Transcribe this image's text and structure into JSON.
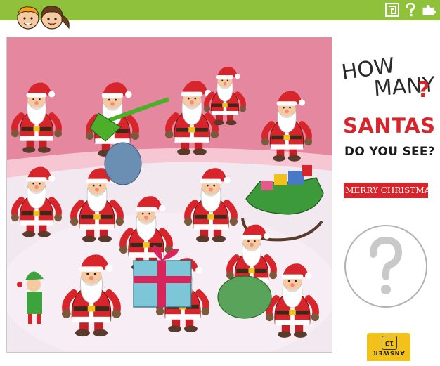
{
  "header": {
    "kids_icon": "two-kids-logo",
    "icons": [
      "maze-icon",
      "question-mark-icon",
      "puzzle-piece-icon"
    ]
  },
  "scene": {
    "description_icon": "santas-illustration"
  },
  "question": {
    "how": "HOW",
    "many": "MANY",
    "qmark": "?",
    "subject": "SANTAS",
    "prompt": "DO YOU SEE?"
  },
  "banner": {
    "star": "★",
    "text": "MERRY CHRISTMAS"
  },
  "answer_area": {
    "placeholder": "?"
  },
  "answer_tab": {
    "number": "13",
    "label": "ANSWER"
  },
  "colors": {
    "topbar": "#8fc23a",
    "accent_red": "#d8242b",
    "tab_yellow": "#f3c21a"
  }
}
